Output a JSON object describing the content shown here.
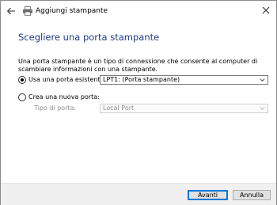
{
  "titlebar": {
    "title": "Aggiungi stampante",
    "back_icon": "arrow-left-icon",
    "app_icon": "printer-icon",
    "close_icon": "close-icon"
  },
  "content": {
    "heading": "Scegliere una porta stampante",
    "description": "Una porta stampante è un tipo di connessione che consente al computer di scambiare informazioni con una stampante.",
    "existing_port": {
      "label": "Usa una porta esistente:",
      "selected": true,
      "value": "LPT1: (Porta stampante)"
    },
    "new_port": {
      "label": "Crea una nuova porta:",
      "selected": false,
      "type_label": "Tipo di porta:",
      "type_value": "Local Port",
      "enabled": false
    }
  },
  "footer": {
    "next_label": "Avanti",
    "cancel_label": "Annulla"
  },
  "colors": {
    "heading": "#1f3b86",
    "footer_bg": "#f0f0f0",
    "primary_border": "#0078d7",
    "disabled_text": "#8e8e8e"
  }
}
